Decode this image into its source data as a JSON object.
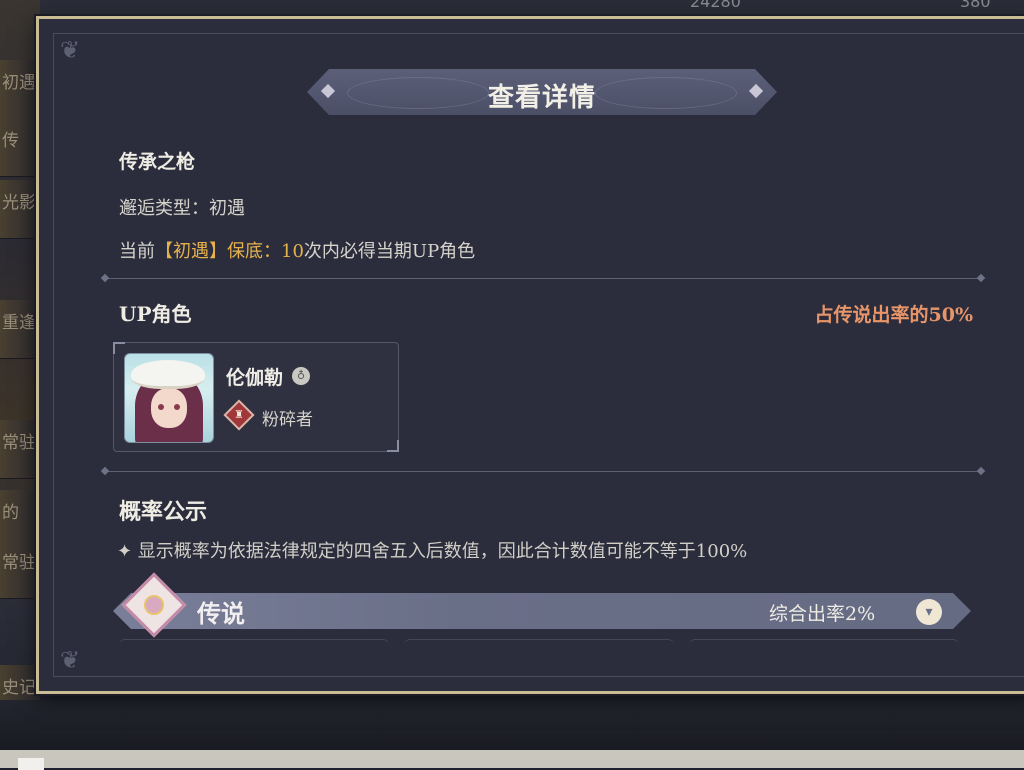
{
  "background": {
    "left_tabs": [
      "初遇",
      "传",
      "光影",
      "重逢",
      "常驻",
      "的",
      "常驻",
      "史记"
    ],
    "top_values": [
      "24280",
      "380"
    ]
  },
  "modal": {
    "title": "查看详情",
    "pool_name": "传承之枪",
    "encounter_type_label": "邂逅类型：",
    "encounter_type_value": "初遇",
    "pity": {
      "prefix": "当前",
      "highlight": "【初遇】保底：",
      "count": "10",
      "suffix": "次内必得当期UP角色"
    },
    "up_section": {
      "title": "UP角色",
      "rate_text": "占传说出率的50%",
      "character": {
        "name": "伦伽勒",
        "element_icon": "element-badge-icon",
        "role_icon": "crusher-role-icon",
        "role": "粉碎者"
      }
    },
    "probability": {
      "title": "概率公示",
      "note": "✦ 显示概率为依据法律规定的四舍五入后数值，因此合计数值可能不等于100%"
    },
    "legendary": {
      "label": "传说",
      "rate": "综合出率2%",
      "toggle_icon": "chevron-down-icon"
    }
  },
  "colors": {
    "highlight_gold": "#e6b14c",
    "up_rate_orange": "#e8956a",
    "frame_gold": "#c9bc95",
    "panel_bg": "#2b2d3c"
  }
}
